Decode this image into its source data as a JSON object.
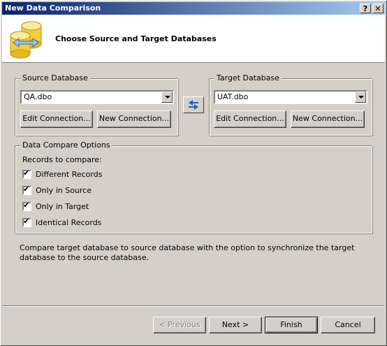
{
  "window": {
    "title": "New Data Comparison",
    "help_button": "?",
    "close_button": "✕"
  },
  "header": {
    "title": "Choose Source and Target Databases",
    "icon": "database-swap-icon"
  },
  "source": {
    "legend": "Source Database",
    "selected": "QA.dbo",
    "edit_label": "Edit Connection...",
    "new_label": "New Connection..."
  },
  "target": {
    "legend": "Target Database",
    "selected": "UAT.dbo",
    "edit_label": "Edit Connection...",
    "new_label": "New Connection..."
  },
  "swap_icon": "swap-arrows-icon",
  "options": {
    "legend": "Data Compare Options",
    "records_label": "Records to compare:",
    "items": [
      {
        "label": "Different Records",
        "checked": true
      },
      {
        "label": "Only in Source",
        "checked": true
      },
      {
        "label": "Only in Target",
        "checked": true
      },
      {
        "label": "Identical Records",
        "checked": true
      }
    ]
  },
  "description": "Compare target database to source database with the option to synchronize the target database to the source database.",
  "footer": {
    "previous_label": "< Previous",
    "next_label": "Next >",
    "finish_label": "Finish",
    "cancel_label": "Cancel"
  }
}
